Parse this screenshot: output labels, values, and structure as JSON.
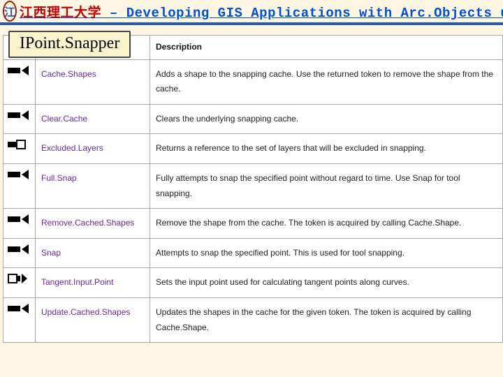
{
  "header": {
    "cn_fragment": "江西理工大学",
    "dash": " – ",
    "en_fragment": "Developing GIS Applications with Arc.Objects using C#.NE",
    "logo_letter": "江"
  },
  "badge": "IPoint.Snapper",
  "columns": {
    "icon": "",
    "name": "",
    "desc": "Description"
  },
  "rows": [
    {
      "icon": "method",
      "name": "Cache.Shapes",
      "desc": "Adds a shape to the snapping cache. Use the returned token to remove the shape from the cache."
    },
    {
      "icon": "method",
      "name": "Clear.Cache",
      "desc": "Clears the underlying snapping cache."
    },
    {
      "icon": "propget",
      "name": "Excluded.Layers",
      "desc": "Returns a reference to the set of layers that will be excluded in snapping."
    },
    {
      "icon": "method",
      "name": "Full.Snap",
      "desc": "Fully attempts to snap the specified point without regard to time. Use Snap for tool snapping."
    },
    {
      "icon": "method",
      "name": "Remove.Cached.Shapes",
      "desc": "Remove the shape from the cache. The token is acquired by calling Cache.Shape."
    },
    {
      "icon": "method",
      "name": "Snap",
      "desc": "Attempts to snap the specified point. This is used for tool snapping."
    },
    {
      "icon": "propput",
      "name": "Tangent.Input.Point",
      "desc": "Sets the input point used for calculating tangent points along curves."
    },
    {
      "icon": "method",
      "name": "Update.Cached.Shapes",
      "desc": "Updates the shapes in the cache for the given token. The token is acquired by calling Cache.Shape."
    }
  ]
}
